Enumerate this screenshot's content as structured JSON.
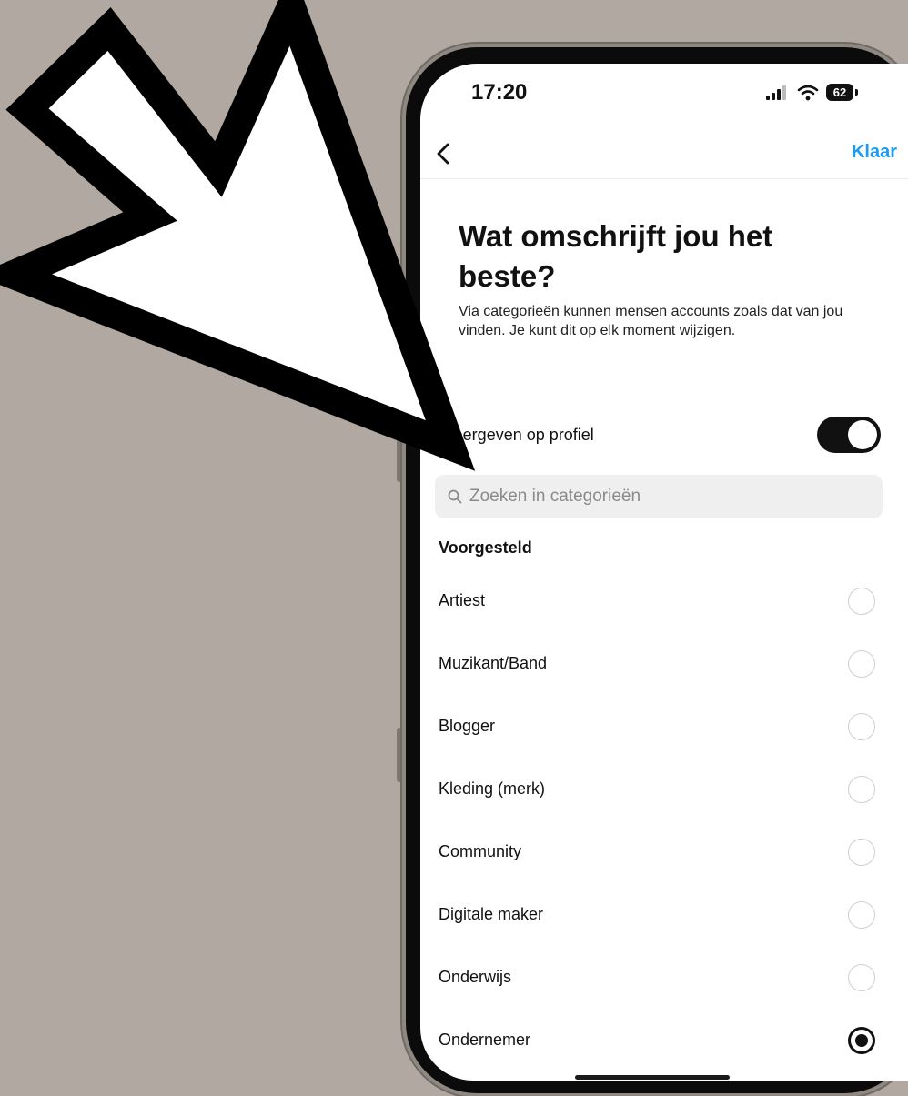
{
  "status_bar": {
    "time": "17:20",
    "battery": "62",
    "icons": [
      "signal-icon",
      "wifi-icon",
      "battery-icon"
    ]
  },
  "nav": {
    "back_icon": "chevron-left-icon",
    "done_label": "Klaar",
    "done_color": "#1d9bf0"
  },
  "header": {
    "title": "Wat omschrijft jou het beste?",
    "subtitle": "Via categorieën kunnen mensen accounts zoals dat van jou vinden. Je kunt dit op elk moment wijzigen."
  },
  "toggle": {
    "label": "Weergeven op profiel",
    "on": true
  },
  "search": {
    "placeholder": "Zoeken in categorieën"
  },
  "section_label": "Voorgesteld",
  "categories": [
    {
      "label": "Artiest",
      "selected": false
    },
    {
      "label": "Muzikant/Band",
      "selected": false
    },
    {
      "label": "Blogger",
      "selected": false
    },
    {
      "label": "Kleding (merk)",
      "selected": false
    },
    {
      "label": "Community",
      "selected": false
    },
    {
      "label": "Digitale maker",
      "selected": false
    },
    {
      "label": "Onderwijs",
      "selected": false
    },
    {
      "label": "Ondernemer",
      "selected": true
    }
  ],
  "colors": {
    "background": "#b1a9a1",
    "arrow_fill": "#ffffff",
    "arrow_outline": "#000000"
  }
}
